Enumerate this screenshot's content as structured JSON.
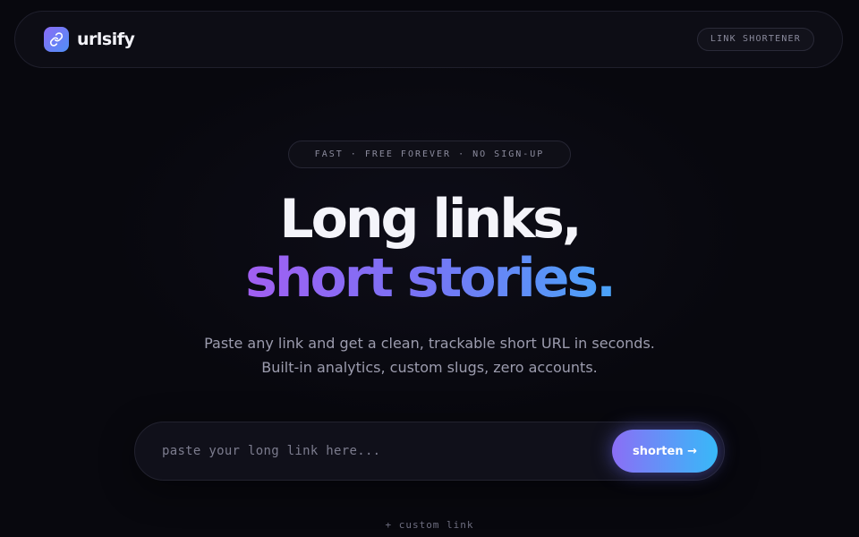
{
  "brand": {
    "name": "urlsify",
    "logo_icon": "link-icon",
    "accent_gradient": [
      "#8b6cf5",
      "#4f8ff7"
    ]
  },
  "nav": {
    "tag_label": "LINK SHORTENER"
  },
  "hero": {
    "badge_text": "FAST · FREE FOREVER · NO SIGN-UP",
    "headline_line1": "Long links,",
    "headline_line2": "short stories.",
    "headline_gradient": [
      "#a25ff2",
      "#4aa3f8"
    ],
    "subtitle_line1": "Paste any link and get a clean, trackable short URL in seconds.",
    "subtitle_line2": "Built-in analytics, custom slugs, zero accounts."
  },
  "shortener": {
    "input_value": "",
    "input_placeholder": "paste your long link here...",
    "button_label": "shorten →",
    "custom_link_label": "+ custom link"
  }
}
